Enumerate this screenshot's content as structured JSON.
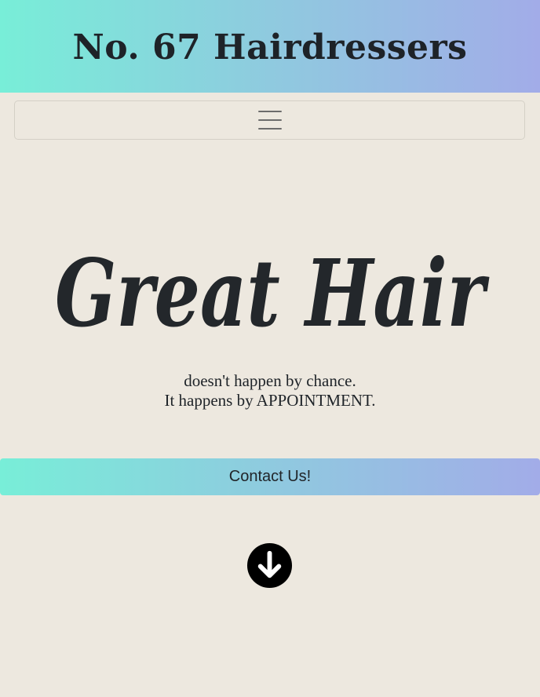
{
  "header": {
    "title": "No. 67 Hairdressers",
    "gradient_start": "#78eed8",
    "gradient_end": "#a2ace8"
  },
  "navbar": {
    "menu_icon": "hamburger-menu-icon"
  },
  "hero": {
    "script_title": "Great Hair",
    "tagline_line1": "doesn't happen by chance.",
    "tagline_line2": "It happens by APPOINTMENT."
  },
  "contact": {
    "label": "Contact Us!"
  },
  "scroll": {
    "icon": "arrow-down-circle-icon"
  },
  "colors": {
    "background": "#ede8df",
    "text": "#1e2328"
  }
}
